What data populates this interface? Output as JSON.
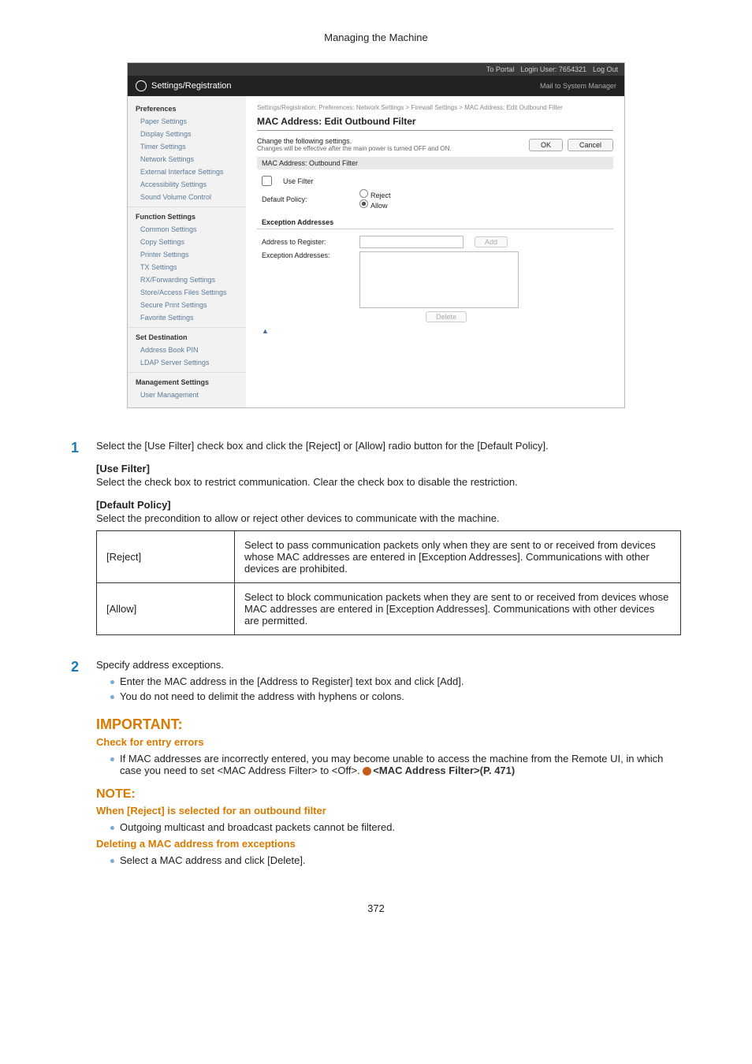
{
  "header": "Managing the Machine",
  "screenshot": {
    "topbar": {
      "portal": "To Portal",
      "login": "Login User: 7654321",
      "logout": "Log Out"
    },
    "title": "Settings/Registration",
    "sysmgr": "Mail to System Manager",
    "sidebar": {
      "groups": [
        {
          "head": "Preferences",
          "items": [
            "Paper Settings",
            "Display Settings",
            "Timer Settings",
            "Network Settings",
            "External Interface Settings",
            "Accessibility Settings",
            "Sound Volume Control"
          ]
        },
        {
          "head": "Function Settings",
          "items": [
            "Common Settings",
            "Copy Settings",
            "Printer Settings",
            "TX Settings",
            "RX/Forwarding Settings",
            "Store/Access Files Settings",
            "Secure Print Settings",
            "Favorite Settings"
          ]
        },
        {
          "head": "Set Destination",
          "items": [
            "Address Book PIN",
            "LDAP Server Settings"
          ]
        },
        {
          "head": "Management Settings",
          "items": [
            "User Management"
          ]
        }
      ]
    },
    "content": {
      "breadcrumb": "Settings/Registration: Preferences: Network Settings > Firewall Settings > MAC Address: Edit Outbound Filter",
      "h2": "MAC Address: Edit Outbound Filter",
      "change": "Change the following settings.",
      "note": "Changes will be effective after the main power is turned OFF and ON.",
      "ok": "OK",
      "cancel": "Cancel",
      "sec1": "MAC Address: Outbound Filter",
      "useFilter": "Use Filter",
      "defPolicy": "Default Policy:",
      "reject": "Reject",
      "allow": "Allow",
      "sec2": "Exception Addresses",
      "addrReg": "Address to Register:",
      "add": "Add",
      "exAddr": "Exception Addresses:",
      "delete": "Delete",
      "footer": "▲"
    }
  },
  "step1": {
    "num": "1",
    "text": "Select the [Use Filter] check box and click the [Reject] or [Allow] radio button for the [Default Policy].",
    "uf_h": "[Use Filter]",
    "uf_b": "Select the check box to restrict communication. Clear the check box to disable the restriction.",
    "dp_h": "[Default Policy]",
    "dp_b": "Select the precondition to allow or reject other devices to communicate with the machine.",
    "table": [
      {
        "k": "[Reject]",
        "v": "Select to pass communication packets only when they are sent to or received from devices whose MAC addresses are entered in [Exception Addresses]. Communications with other devices are prohibited."
      },
      {
        "k": "[Allow]",
        "v": "Select to block communication packets when they are sent to or received from devices whose MAC addresses are entered in [Exception Addresses]. Communications with other devices are permitted."
      }
    ]
  },
  "step2": {
    "num": "2",
    "text": "Specify address exceptions.",
    "b1": "Enter the MAC address in the [Address to Register] text box and click [Add].",
    "b2": "You do not need to delimit the address with hyphens or colons."
  },
  "important": {
    "title": "IMPORTANT:",
    "sub": "Check for entry errors",
    "b_pre": "If MAC addresses are incorrectly entered, you may become unable to access the machine from the Remote UI, in which case you need to set <MAC Address Filter> to <Off>. ",
    "link": "<MAC Address Filter>(P. 471)"
  },
  "note": {
    "title": "NOTE:",
    "s1": "When [Reject] is selected for an outbound filter",
    "b1": "Outgoing multicast and broadcast packets cannot be filtered.",
    "s2": "Deleting a MAC address from exceptions",
    "b2": "Select a MAC address and click [Delete]."
  },
  "pageNum": "372"
}
